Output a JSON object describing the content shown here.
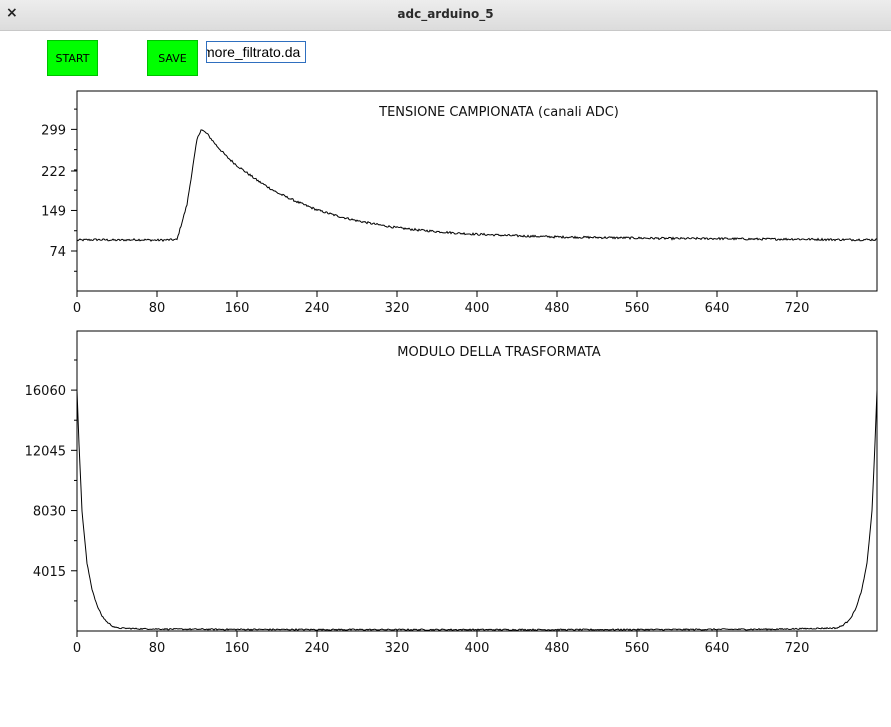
{
  "window": {
    "title": "adc_arduino_5",
    "close_glyph": "×"
  },
  "toolbar": {
    "start_label": "START",
    "save_label": "SAVE",
    "filename_value": "more_filtrato.da"
  },
  "chart_data": [
    {
      "type": "line",
      "title": "TENSIONE CAMPIONATA (canali ADC)",
      "xlabel": "",
      "ylabel": "",
      "xlim": [
        0,
        800
      ],
      "ylim": [
        0,
        370
      ],
      "x_ticks": [
        0,
        80,
        160,
        240,
        320,
        400,
        480,
        560,
        640,
        720
      ],
      "y_ticks": [
        74,
        149,
        222,
        299
      ],
      "series": [
        {
          "x": [
            0,
            20,
            40,
            60,
            80,
            100,
            110,
            120,
            124,
            130,
            140,
            150,
            160,
            180,
            200,
            220,
            240,
            260,
            280,
            300,
            320,
            340,
            360,
            380,
            400,
            440,
            480,
            520,
            560,
            600,
            640,
            680,
            720,
            760,
            800
          ],
          "values": [
            94,
            95,
            94,
            95,
            94,
            95,
            160,
            280,
            299,
            291,
            268,
            248,
            232,
            205,
            182,
            165,
            150,
            139,
            130,
            123,
            117,
            113,
            110,
            107,
            105,
            102,
            100,
            99,
            98,
            97,
            97,
            96,
            96,
            95,
            95
          ]
        }
      ],
      "grid": false
    },
    {
      "type": "line",
      "title": "MODULO DELLA TRASFORMATA",
      "xlabel": "",
      "ylabel": "",
      "xlim": [
        0,
        800
      ],
      "ylim": [
        0,
        20000
      ],
      "x_ticks": [
        0,
        80,
        160,
        240,
        320,
        400,
        480,
        560,
        640,
        720
      ],
      "y_ticks": [
        4015,
        8030,
        12045,
        16060
      ],
      "series": [
        {
          "x": [
            0,
            2,
            5,
            10,
            15,
            20,
            25,
            30,
            35,
            40,
            60,
            100,
            200,
            300,
            400,
            500,
            600,
            700,
            760,
            765,
            770,
            775,
            780,
            785,
            790,
            795,
            798,
            800
          ],
          "values": [
            16060,
            12500,
            8000,
            4500,
            2800,
            1700,
            1000,
            600,
            350,
            200,
            150,
            120,
            100,
            90,
            90,
            90,
            100,
            120,
            200,
            350,
            600,
            1000,
            1700,
            2800,
            4500,
            8000,
            12500,
            16060
          ]
        }
      ],
      "grid": false
    }
  ]
}
